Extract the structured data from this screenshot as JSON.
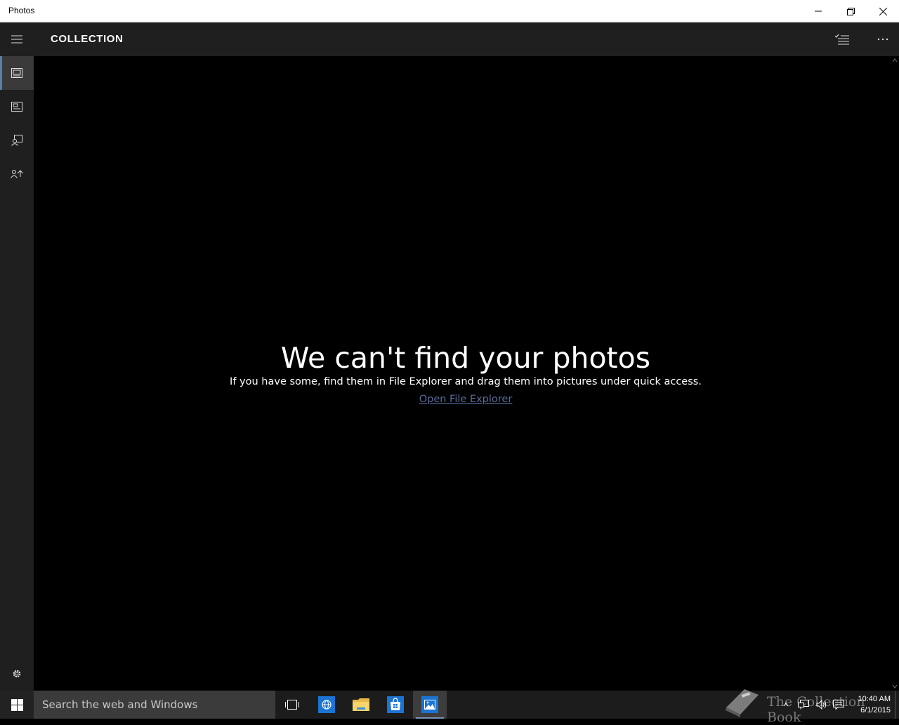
{
  "window": {
    "title": "Photos"
  },
  "header": {
    "title": "COLLECTION"
  },
  "sidebar": {
    "items": [
      {
        "name": "collection",
        "icon": "collection-icon",
        "active": true
      },
      {
        "name": "albums",
        "icon": "albums-icon",
        "active": false
      },
      {
        "name": "people",
        "icon": "people-icon",
        "active": false
      },
      {
        "name": "import",
        "icon": "import-icon",
        "active": false
      }
    ],
    "settings_icon": "gear-icon"
  },
  "empty_state": {
    "heading": "We can't find your photos",
    "message": "If you have some, find them in File Explorer and drag them into pictures under quick access.",
    "link": "Open File Explorer"
  },
  "taskbar": {
    "search_placeholder": "Search the web and Windows",
    "apps": [
      "task-view-icon",
      "edge-icon",
      "file-explorer-icon",
      "store-icon",
      "photos-icon"
    ],
    "time": "10:40 AM",
    "date": "6/1/2015",
    "watermark": "The Collection Book"
  },
  "colors": {
    "accent": "#5a7fa8",
    "link": "#5a6c9a",
    "chrome": "#1f1f1f",
    "background": "#000000"
  }
}
